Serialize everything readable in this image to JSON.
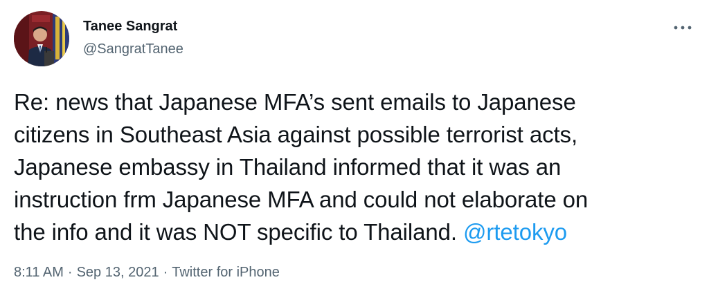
{
  "author": {
    "name": "Tanee Sangrat",
    "handle": "@SangratTanee",
    "avatar_icon": "profile-photo-man-at-podium"
  },
  "more_icon": "more-horizontal-icon",
  "tweet": {
    "lines": [
      "Re: news that Japanese MFA’s sent emails to Japanese",
      "citizens in Southeast Asia against possible terrorist acts,",
      "Japanese embassy in Thailand informed that it was an",
      "instruction frm Japanese MFA and could not elaborate on",
      "the info and it was NOT specific to Thailand."
    ],
    "mention": "@rtetokyo"
  },
  "meta": {
    "time": "8:11 AM",
    "date": "Sep 13, 2021",
    "separator": "·",
    "source": "Twitter for iPhone"
  },
  "colors": {
    "text": "#0f1419",
    "secondary": "#536471",
    "link": "#1d9bf0"
  }
}
